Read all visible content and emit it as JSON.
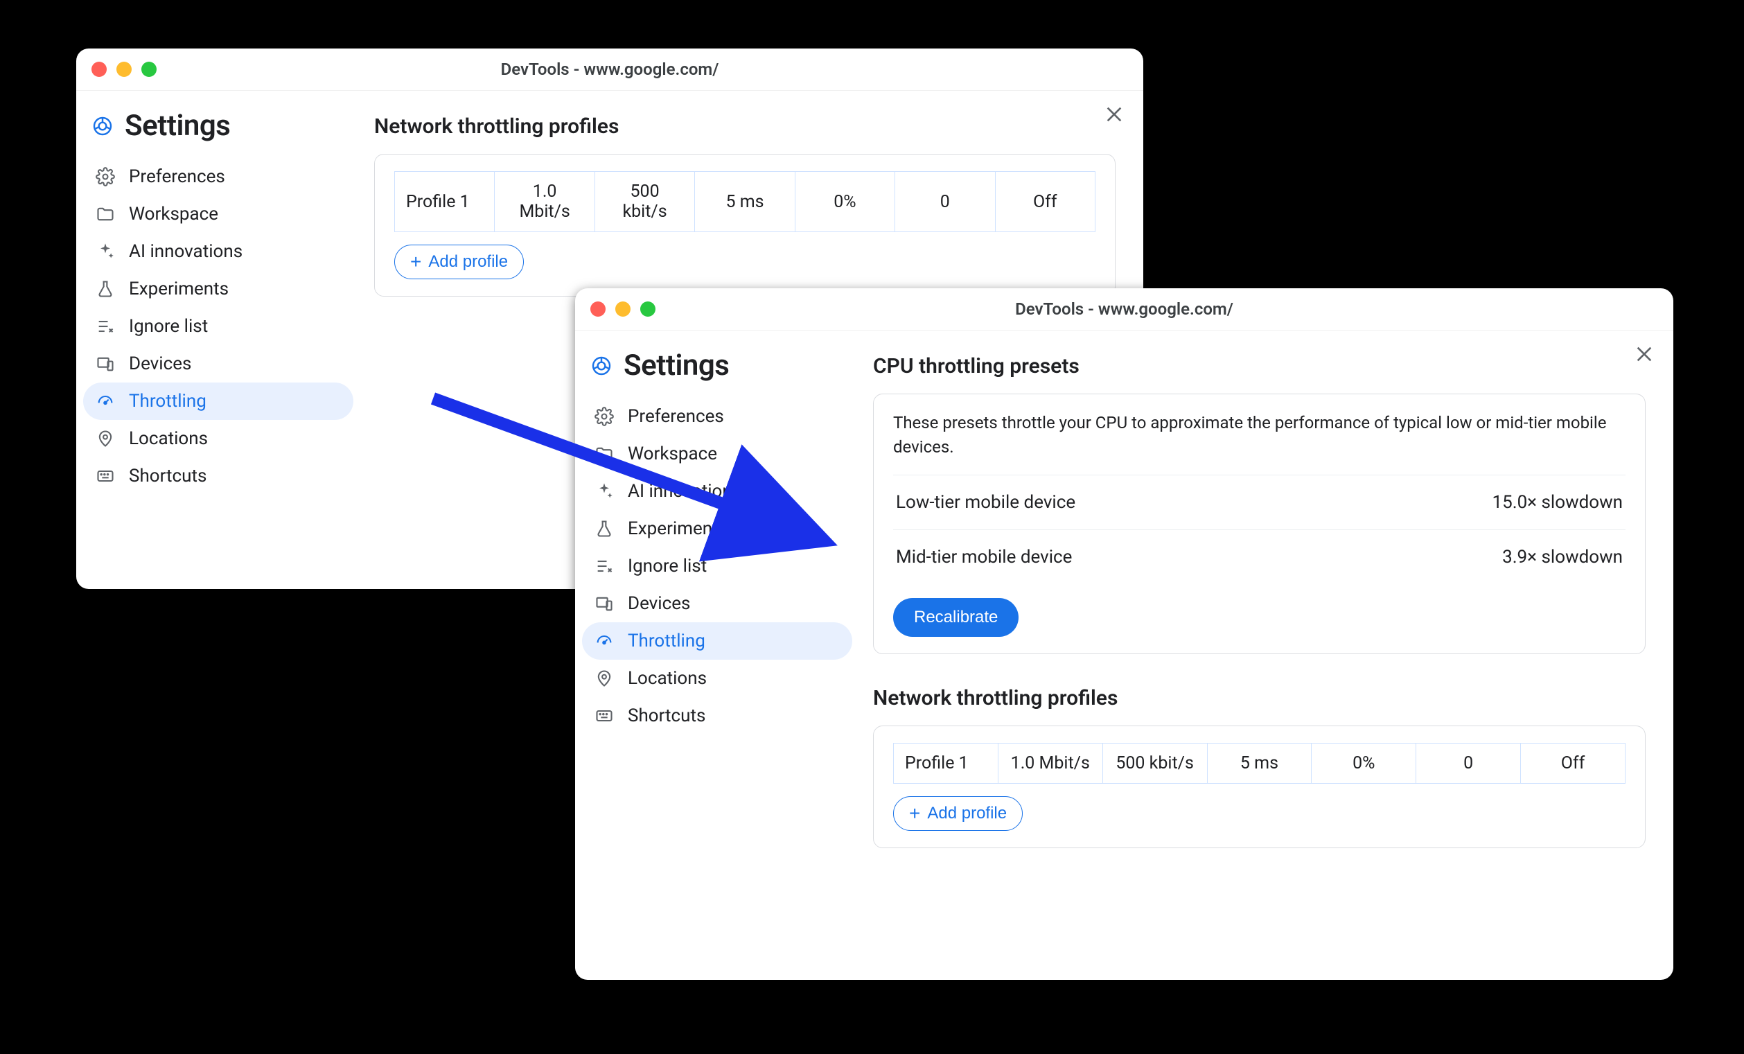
{
  "window_title": "DevTools - www.google.com/",
  "settings_title": "Settings",
  "sidebar": {
    "items": [
      {
        "id": "preferences",
        "label": "Preferences"
      },
      {
        "id": "workspace",
        "label": "Workspace"
      },
      {
        "id": "ai",
        "label": "AI innovations"
      },
      {
        "id": "experiments",
        "label": "Experiments"
      },
      {
        "id": "ignore",
        "label": "Ignore list"
      },
      {
        "id": "devices",
        "label": "Devices"
      },
      {
        "id": "throttling",
        "label": "Throttling"
      },
      {
        "id": "locations",
        "label": "Locations"
      },
      {
        "id": "shortcuts",
        "label": "Shortcuts"
      }
    ]
  },
  "network_section": {
    "heading": "Network throttling profiles",
    "add_label": "Add profile",
    "row": {
      "name": "Profile 1",
      "down": "1.0 Mbit/s",
      "up": "500 kbit/s",
      "latency": "5 ms",
      "loss": "0%",
      "queue": "0",
      "state": "Off"
    }
  },
  "cpu_section": {
    "heading": "CPU throttling presets",
    "description": "These presets throttle your CPU to approximate the performance of typical low or mid-tier mobile devices.",
    "rows": [
      {
        "name": "Low-tier mobile device",
        "value": "15.0× slowdown"
      },
      {
        "name": "Mid-tier mobile device",
        "value": "3.9× slowdown"
      }
    ],
    "recalibrate": "Recalibrate"
  }
}
